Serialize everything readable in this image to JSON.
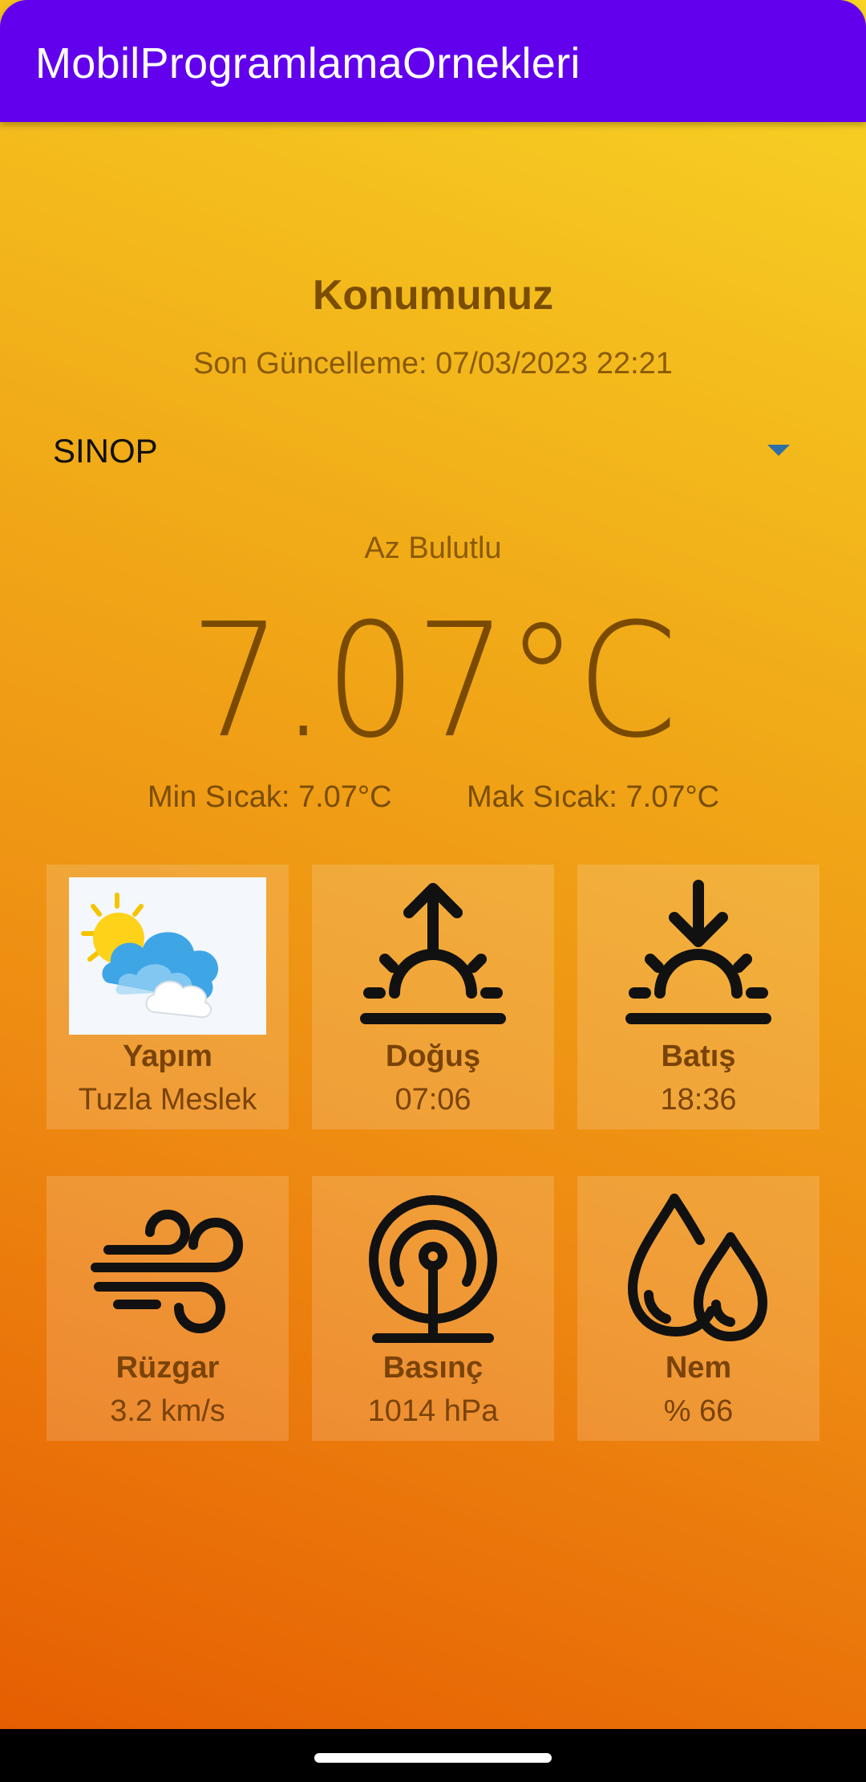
{
  "app": {
    "title": "MobilProgramlamaOrnekleri"
  },
  "location": {
    "title": "Konumunuz",
    "last_update": "Son Güncelleme: 07/03/2023 22:21",
    "city_selected": "SINOP"
  },
  "weather": {
    "description": "Az Bulutlu",
    "temperature": "7.07°C",
    "min_temp": "Min Sıcak: 7.07°C",
    "max_temp": "Mak Sıcak: 7.07°C"
  },
  "cards": [
    {
      "label": "Yapım",
      "value": "Tuzla Meslek",
      "icon": "partly-cloudy-image"
    },
    {
      "label": "Doğuş",
      "value": "07:06",
      "icon": "sunrise-icon"
    },
    {
      "label": "Batış",
      "value": "18:36",
      "icon": "sunset-icon"
    },
    {
      "label": "Rüzgar",
      "value": "3.2 km/s",
      "icon": "wind-icon"
    },
    {
      "label": "Basınç",
      "value": "1014 hPa",
      "icon": "pressure-icon"
    },
    {
      "label": "Nem",
      "value": "% 66",
      "icon": "humidity-icon"
    }
  ],
  "colors": {
    "appbar": "#6200ee",
    "text_primary": "#7a4d00",
    "gradient_top": "#f8d425",
    "gradient_bottom": "#e65e02"
  }
}
